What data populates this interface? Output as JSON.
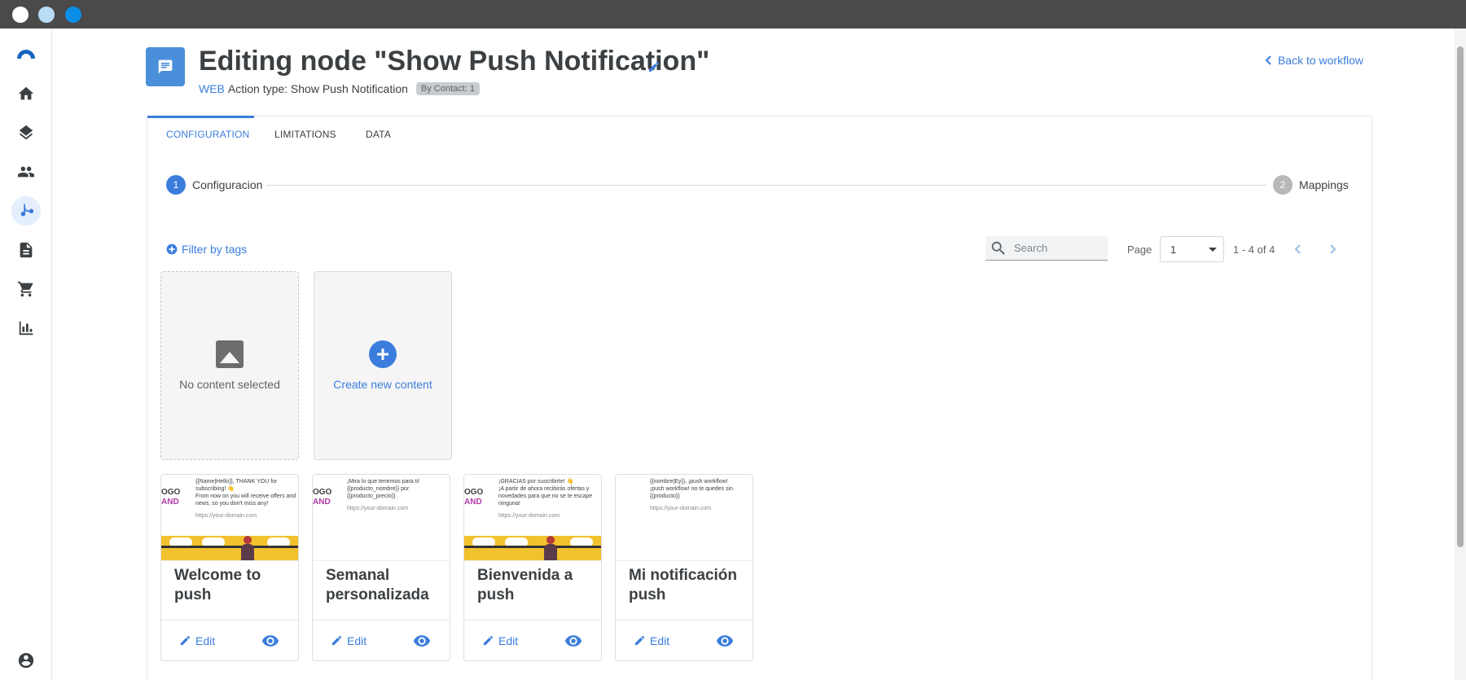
{
  "window": {
    "title": "Editing node \"Show Push Notification\""
  },
  "sidebar": {
    "items": [
      {
        "name": "home",
        "icon": "home-icon"
      },
      {
        "name": "layers",
        "icon": "layers-icon"
      },
      {
        "name": "contacts",
        "icon": "people-icon"
      },
      {
        "name": "workflows",
        "icon": "workflow-icon"
      },
      {
        "name": "documents",
        "icon": "document-icon"
      },
      {
        "name": "shop",
        "icon": "cart-icon"
      },
      {
        "name": "analytics",
        "icon": "bar-chart-icon"
      },
      {
        "name": "account",
        "icon": "account-icon"
      }
    ],
    "active": "workflows"
  },
  "header": {
    "title": "Editing node \"Show Push Notification\"",
    "channel": "WEB",
    "action_type": "Action type: Show Push Notification",
    "badge": "By Contact: 1",
    "back_label": "Back to workflow"
  },
  "tabs": [
    {
      "label": "CONFIGURATION",
      "active": true
    },
    {
      "label": "LIMITATIONS",
      "active": false
    },
    {
      "label": "DATA",
      "active": false
    }
  ],
  "stepper": {
    "steps": [
      {
        "number": "1",
        "label": "Configuracion",
        "active": true
      },
      {
        "number": "2",
        "label": "Mappings",
        "active": false
      }
    ]
  },
  "toolbar": {
    "filter_label": "Filter by tags",
    "search_placeholder": "Search",
    "page_label": "Page",
    "page_value": "1",
    "range_text": "1 - 4 of 4"
  },
  "tiles": {
    "empty_label": "No content selected",
    "create_label": "Create new content"
  },
  "contents": [
    {
      "title": "Welcome to push",
      "preview_lines": [
        "{{Name|Hello}}, THANK YOU for subscribing! 👋",
        "From now on you will receive offers and news, so you don't miss any!"
      ],
      "preview_url": "https://your-domain.com",
      "has_banner": true,
      "logo": [
        "OGO",
        "AND"
      ],
      "edit_label": "Edit"
    },
    {
      "title": "Semanal personalizada",
      "preview_lines": [
        "¡Mira lo que tenemos para ti!",
        "{{producto_nombre}} por {{producto_precio}}"
      ],
      "preview_url": "https://your-domain.com",
      "has_banner": false,
      "logo": [
        "OGO",
        "AND"
      ],
      "edit_label": "Edit"
    },
    {
      "title": "Bienvenida a push",
      "preview_lines": [
        "¡GRACIAS por suscribirte! 👋",
        "¡A partir de ahora recibirás ofertas y novedades para que no se te escape ninguna!"
      ],
      "preview_url": "https://your-domain.com",
      "has_banner": true,
      "logo": [
        "OGO",
        "AND"
      ],
      "edit_label": "Edit"
    },
    {
      "title": "Mi notificación push",
      "preview_lines": [
        "{{nombre|Ey}}, ¡push workflow!",
        "¡push workflow! no te quedes sin {{producto}}"
      ],
      "preview_url": "https://your-domain.com",
      "has_banner": false,
      "logo": [
        "",
        ""
      ],
      "edit_label": "Edit"
    }
  ],
  "colors": {
    "accent": "#3b7ddd",
    "node_badge": "#4a8fd9",
    "chrome": "#4a4a4a"
  }
}
